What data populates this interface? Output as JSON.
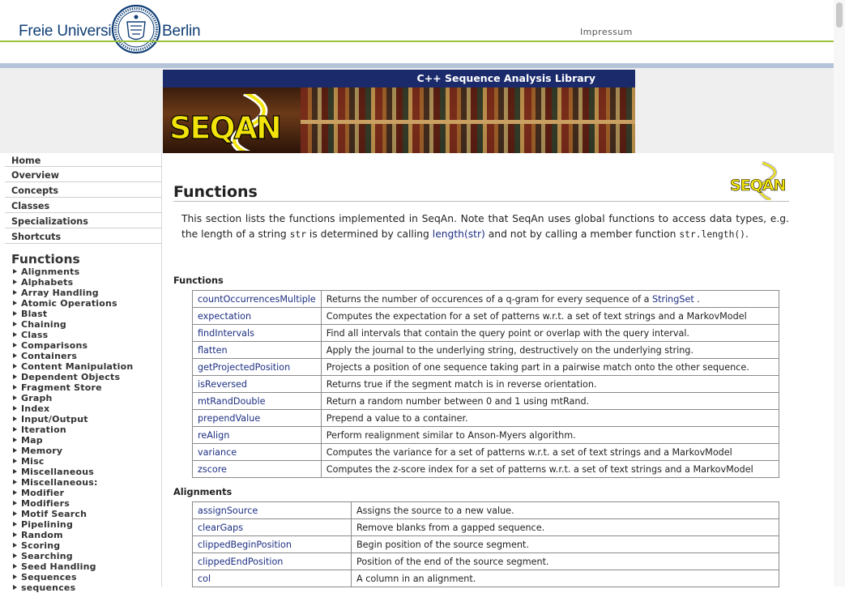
{
  "header": {
    "university_left": "Freie Universität",
    "university_right": "Berlin",
    "impressum": "Impressum"
  },
  "banner": {
    "title": "C++ Sequence Analysis Library",
    "logo_text": "SEQAN"
  },
  "nav": {
    "main_items": [
      "Home",
      "Overview",
      "Concepts",
      "Classes",
      "Specializations",
      "Shortcuts"
    ],
    "section_title": "Functions",
    "sub_items": [
      "Alignments",
      "Alphabets",
      "Array Handling",
      "Atomic Operations",
      "Blast",
      "Chaining",
      "Class",
      "Comparisons",
      "Containers",
      "Content Manipulation",
      "Dependent Objects",
      "Fragment Store",
      "Graph",
      "Index",
      "Input/Output",
      "Iteration",
      "Map",
      "Memory",
      "Misc",
      "Miscellaneous",
      "Miscellaneous:",
      "Modifier",
      "Modifiers",
      "Motif Search",
      "Pipelining",
      "Random",
      "Scoring",
      "Searching",
      "Seed Handling",
      "Sequences",
      "sequences"
    ]
  },
  "content": {
    "corner_logo_text": "SEQAN",
    "page_title": "Functions",
    "intro": {
      "part1": "This section lists the functions implemented in SeqAn. Note that SeqAn uses global functions to access data types, e.g. the length of a string ",
      "code1": "str",
      "part2": " is determined by calling ",
      "link": "length(str)",
      "part3": " and not by calling a member function ",
      "code2": "str.length()",
      "part4": "."
    },
    "sections": [
      {
        "heading": "Functions",
        "rows": [
          {
            "name": "countOccurrencesMultiple",
            "desc": "Returns the number of occurences of a q-gram for every sequence of a ",
            "desc_link": "StringSet",
            "desc_after": " ."
          },
          {
            "name": "expectation",
            "desc": "Computes the expectation for a set of patterns w.r.t. a set of text strings and a MarkovModel"
          },
          {
            "name": "findIntervals",
            "desc": "Find all intervals that contain the query point or overlap with the query interval."
          },
          {
            "name": "flatten",
            "desc": "Apply the journal to the underlying string, destructively on the underlying string."
          },
          {
            "name": "getProjectedPosition",
            "desc": "Projects a position of one sequence taking part in a pairwise match onto the other sequence."
          },
          {
            "name": "isReversed",
            "desc": "Returns true if the segment match is in reverse orientation."
          },
          {
            "name": "mtRandDouble",
            "desc": "Return a random number between 0 and 1 using mtRand."
          },
          {
            "name": "prependValue",
            "desc": "Prepend a value to a container."
          },
          {
            "name": "reAlign",
            "desc": "Perform realignment similar to Anson-Myers algorithm."
          },
          {
            "name": "variance",
            "desc": "Computes the variance for a set of patterns w.r.t. a set of text strings and a MarkovModel"
          },
          {
            "name": "zscore",
            "desc": "Computes the z-score index for a set of patterns w.r.t. a set of text strings and a MarkovModel"
          }
        ]
      },
      {
        "heading": "Alignments",
        "rows": [
          {
            "name": "assignSource",
            "desc": "Assigns the source to a new value."
          },
          {
            "name": "clearGaps",
            "desc": "Remove blanks from a gapped sequence."
          },
          {
            "name": "clippedBeginPosition",
            "desc": "Begin position of the source segment."
          },
          {
            "name": "clippedEndPosition",
            "desc": "Position of the end of the source segment."
          },
          {
            "name": "col",
            "desc": "A column in an alignment."
          }
        ]
      }
    ]
  },
  "colors": {
    "fu_blue": "#0f3e75",
    "green_rule": "#9bc23d",
    "banner_navy": "#1b2a6b",
    "link_blue": "#1d2f83",
    "logo_yellow": "#f2e30a"
  }
}
